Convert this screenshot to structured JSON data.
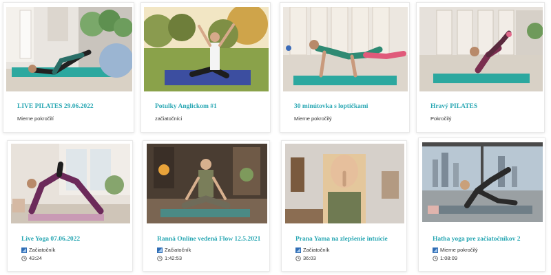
{
  "colors": {
    "accent": "#2ba8b4",
    "text": "#333333",
    "card_border": "#e8e8e8"
  },
  "icons": {
    "level": "signal-bars-icon",
    "duration": "clock-icon"
  },
  "rows": [
    {
      "cards": [
        {
          "title": "LIVE PILATES 29.06.2022",
          "level": "Mierne pokročilí"
        },
        {
          "title": "Potulky Anglickom #1",
          "level": "začiatočníci"
        },
        {
          "title": "30 minútovka s loptičkami",
          "level": "Mierne pokročilý"
        },
        {
          "title": "Hravý PILATES",
          "level": "Pokročilý"
        }
      ]
    },
    {
      "cards": [
        {
          "title": "Live Yoga 07.06.2022",
          "level": "Začiatočník",
          "duration": "43:24"
        },
        {
          "title": "Ranná Online vedená Flow 12.5.2021",
          "level": "Začiatočník",
          "duration": "1:42:53"
        },
        {
          "title": "Prana Yama na zlepšenie intuície",
          "level": "Začiatočník",
          "duration": "36:03"
        },
        {
          "title": "Hatha yoga pre začiatočníkov 2",
          "level": "Mierne pokročilý",
          "duration": "1:08:09"
        }
      ]
    }
  ]
}
